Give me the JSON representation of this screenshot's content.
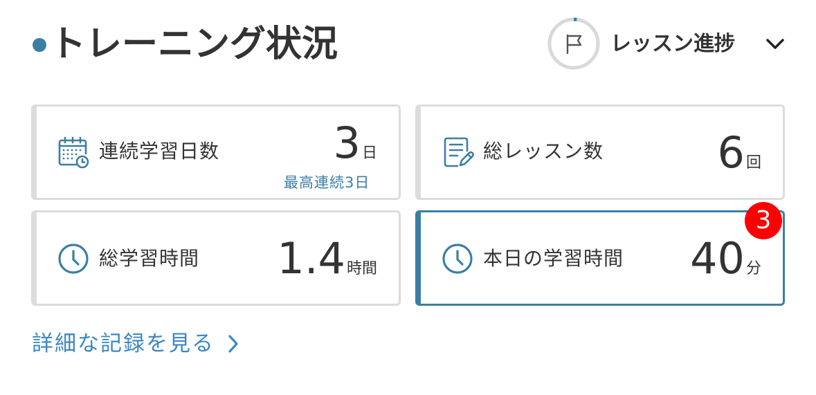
{
  "header": {
    "title": "トレーニング状況",
    "progress_label": "レッスン進捗",
    "progress_value": 0.02,
    "accent_color": "#3b7ea3",
    "ring_track_color": "#d9d9d9",
    "icons": {
      "progress": "flag-icon",
      "dropdown": "chevron-down-icon"
    }
  },
  "stats": [
    {
      "label": "連続学習日数",
      "value": "3",
      "unit": "日",
      "note": "最高連続3日",
      "icon": "calendar-clock-icon"
    },
    {
      "label": "総レッスン数",
      "value": "6",
      "unit": "回",
      "icon": "document-edit-icon"
    },
    {
      "label": "総学習時間",
      "value": "1.4",
      "unit": "時間",
      "icon": "clock-icon"
    },
    {
      "label": "本日の学習時間",
      "value": "40",
      "unit": "分",
      "icon": "clock-icon",
      "badge": "3",
      "badge_color": "#ff0000",
      "active": true
    }
  ],
  "link": {
    "label": "詳細な記録を見る",
    "icon": "chevron-right-icon",
    "color": "#3b87c4"
  }
}
